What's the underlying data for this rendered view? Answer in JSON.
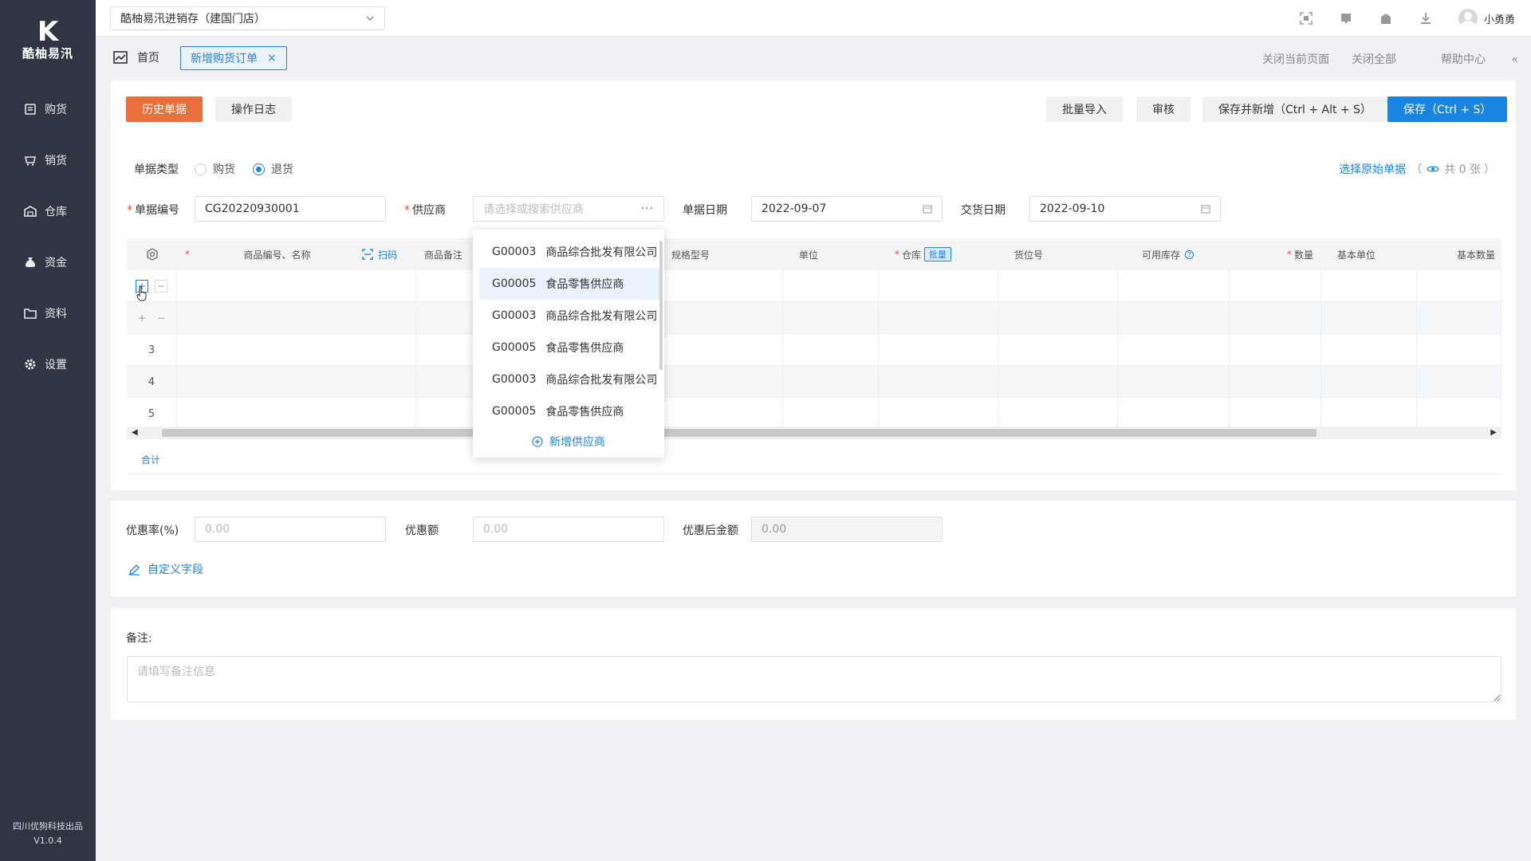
{
  "brand": {
    "name": "酷柚易汛",
    "mark": "K"
  },
  "sidebar": {
    "items": [
      {
        "label": "购货",
        "icon": "purchase-icon"
      },
      {
        "label": "销货",
        "icon": "sales-icon"
      },
      {
        "label": "仓库",
        "icon": "warehouse-icon"
      },
      {
        "label": "资金",
        "icon": "money-icon"
      },
      {
        "label": "资料",
        "icon": "data-icon"
      },
      {
        "label": "设置",
        "icon": "gear-icon"
      }
    ],
    "footer_company": "四川优狗科技出品",
    "footer_version": "V1.0.4"
  },
  "topbar": {
    "store": "酷柚易汛进销存（建国门店）",
    "user": "小勇勇"
  },
  "tabs": {
    "home": "首页",
    "active": "新增购货订单",
    "close_current": "关闭当前页面",
    "close_all": "关闭全部",
    "help": "帮助中心"
  },
  "toolbar": {
    "history": "历史单据",
    "log": "操作日志",
    "import": "批量导入",
    "audit": "审核",
    "save_new": "保存并新增（Ctrl + Alt + S）",
    "save": "保存（Ctrl + S）"
  },
  "form": {
    "type_label": "单据类型",
    "type_options": [
      "购货",
      "退货"
    ],
    "type_selected": "退货",
    "select_original": "选择原始单据",
    "original_count": "共 0 张",
    "no_label": "单据编号",
    "no_value": "CG20220930001",
    "supplier_label": "供应商",
    "supplier_placeholder": "请选择或搜索供应商",
    "date_label": "单据日期",
    "date_value": "2022-09-07",
    "delivery_label": "交货日期",
    "delivery_value": "2022-09-10"
  },
  "table": {
    "headers": {
      "goods": "商品编号、名称",
      "scan": "扫码",
      "remark": "商品备注",
      "spec": "规格型号",
      "unit": "单位",
      "warehouse": "仓库",
      "batch": "批量",
      "location": "货位号",
      "stock": "可用库存",
      "qty": "数量",
      "base_unit": "基本单位",
      "base_qty": "基本数量"
    },
    "row_numbers": [
      "3",
      "4",
      "5"
    ],
    "total_label": "合计"
  },
  "dropdown": {
    "items": [
      {
        "code": "G00003",
        "name": "商品综合批发有限公司"
      },
      {
        "code": "G00005",
        "name": "食品零售供应商"
      },
      {
        "code": "G00003",
        "name": "商品综合批发有限公司"
      },
      {
        "code": "G00005",
        "name": "食品零售供应商"
      },
      {
        "code": "G00003",
        "name": "商品综合批发有限公司"
      },
      {
        "code": "G00005",
        "name": "食品零售供应商"
      }
    ],
    "add_label": "新增供应商"
  },
  "discount": {
    "rate_label": "优惠率(%)",
    "rate_placeholder": "0.00",
    "amount_label": "优惠额",
    "amount_placeholder": "0.00",
    "after_label": "优惠后金额",
    "after_value": "0.00",
    "custom_label": "自定义字段"
  },
  "remark": {
    "label": "备注:",
    "placeholder": "请填写备注信息"
  }
}
